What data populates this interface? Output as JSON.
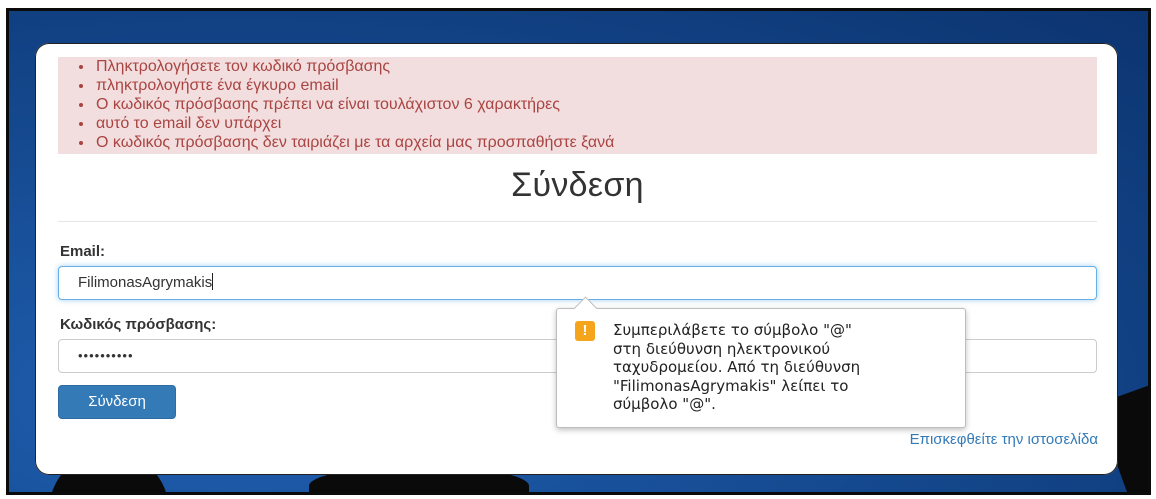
{
  "errors": [
    "Πληκτρολογήσετε τον κωδικό πρόσβασης",
    "πληκτρολογήστε ένα έγκυρο email",
    "Ο κωδικός πρόσβασης πρέπει να είναι τουλάχιστον 6 χαρακτήρες",
    "αυτό το email δεν υπάρχει",
    "Ο κωδικός πρόσβασης δεν ταιριάζει με τα αρχεία μας προσπαθήστε ξανά"
  ],
  "form": {
    "title": "Σύνδεση",
    "email_label": "Email:",
    "email_value": "FilimonasAgrymakis",
    "password_label": "Κωδικός πρόσβασης:",
    "password_value": "••••••••••",
    "submit_label": "Σύνδεση",
    "visit_link": "Επισκεφθείτε την ιστοσελίδα"
  },
  "validation_tooltip": {
    "icon": "warning-icon",
    "icon_glyph": "!",
    "message": "Συμπεριλάβετε το σύμβολο \"@\"\nστη διεύθυνση ηλεκτρονικού\nταχυδρομείου. Από τη διεύθυνση\n\"FilimonasAgrymakis\" λείπει το\nσύμβολο \"@\"."
  },
  "colors": {
    "alert_bg": "#f2dede",
    "alert_text": "#a94442",
    "primary": "#337ab7",
    "warning": "#f4a51c"
  }
}
